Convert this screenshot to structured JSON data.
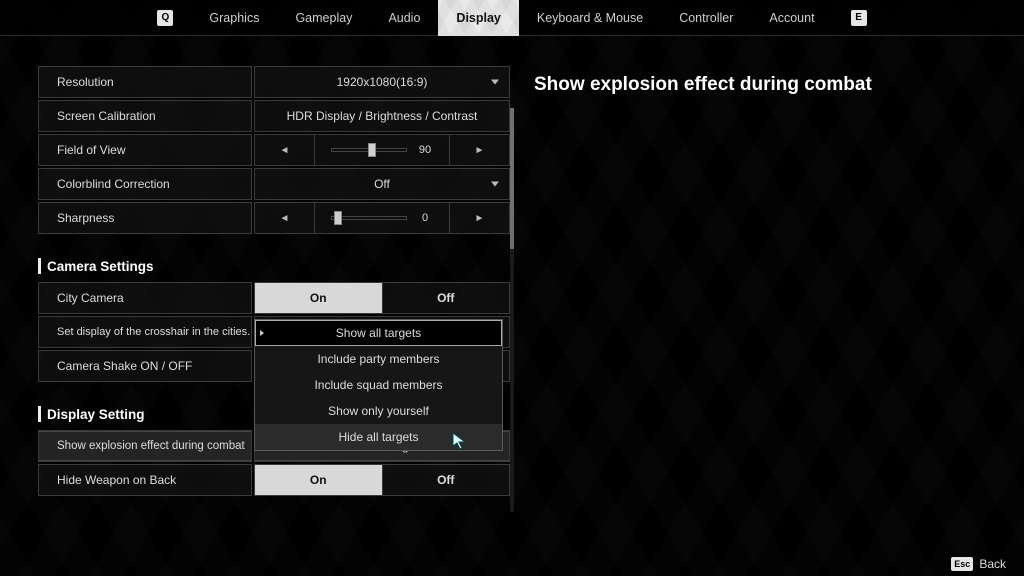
{
  "nav": {
    "keyPrev": "Q",
    "keyNext": "E",
    "tabs": [
      "Graphics",
      "Gameplay",
      "Audio",
      "Display",
      "Keyboard & Mouse",
      "Controller",
      "Account"
    ],
    "active": "Display"
  },
  "detail": {
    "title": "Show explosion effect during combat"
  },
  "rows": {
    "resolution": {
      "label": "Resolution",
      "value": "1920x1080(16:9)"
    },
    "calibration": {
      "label": "Screen Calibration",
      "value": "HDR Display / Brightness / Contrast"
    },
    "fov": {
      "label": "Field of View",
      "value": "90",
      "pct": 55
    },
    "colorblind": {
      "label": "Colorblind Correction",
      "value": "Off"
    },
    "sharpness": {
      "label": "Sharpness",
      "value": "0",
      "pct": 4
    },
    "citycam": {
      "label": "City Camera",
      "on": "On",
      "off": "Off",
      "sel": "on"
    },
    "crosshair": {
      "label": "Set display of the crosshair in the cities."
    },
    "camshake": {
      "label": "Camera Shake ON / OFF"
    },
    "explosion": {
      "label": "Show explosion effect during combat",
      "value": "Show all targets"
    },
    "hideweapon": {
      "label": "Hide Weapon on Back",
      "on": "On",
      "off": "Off",
      "sel": "on"
    }
  },
  "sections": {
    "camera": "Camera Settings",
    "display": "Display Setting"
  },
  "dropdown": {
    "items": [
      "Show all targets",
      "Include party members",
      "Include squad members",
      "Show only yourself",
      "Hide all targets"
    ],
    "highlight": 0,
    "hover": 4
  },
  "footer": {
    "esc": "Esc",
    "back": "Back"
  }
}
